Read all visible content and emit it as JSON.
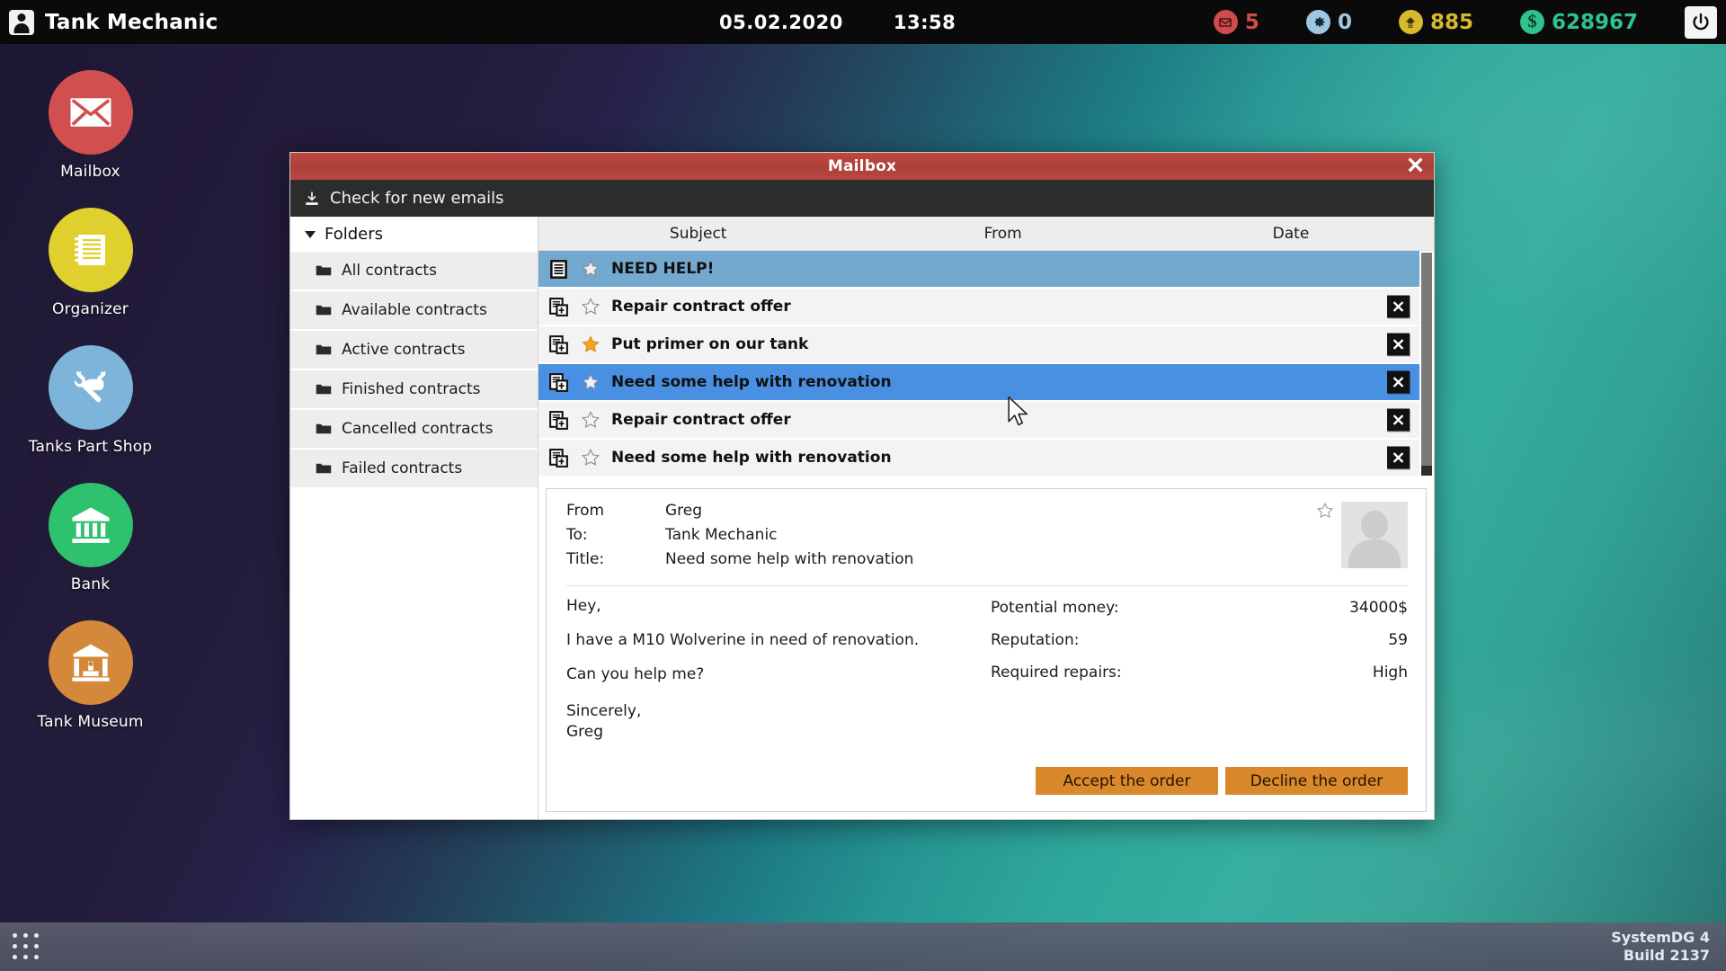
{
  "topbar": {
    "avatar_icon": "user-avatar-icon",
    "player_name": "Tank Mechanic",
    "date": "05.02.2020",
    "time": "13:58",
    "stats": [
      {
        "id": "mail",
        "icon": "mail-icon",
        "value": "5",
        "color": "#d14b4b"
      },
      {
        "id": "repairs",
        "icon": "gear-icon",
        "value": "0",
        "color": "#9fc6e3"
      },
      {
        "id": "reputation",
        "icon": "reputation-icon",
        "value": "885",
        "color": "#d8b92e"
      },
      {
        "id": "money",
        "icon": "dollar-icon",
        "value": "628967",
        "color": "#2ec28d"
      }
    ],
    "power_icon": "power-icon"
  },
  "desktop_icons": [
    {
      "label": "Mailbox",
      "icon": "envelope-icon",
      "color": "#d14f4f"
    },
    {
      "label": "Organizer",
      "icon": "notepad-icon",
      "color": "#e0d02e"
    },
    {
      "label": "Tanks Part Shop",
      "icon": "tank-wrench-icon",
      "color": "#7db4da"
    },
    {
      "label": "Bank",
      "icon": "bank-icon",
      "color": "#2ec26e"
    },
    {
      "label": "Tank Museum",
      "icon": "museum-icon",
      "color": "#d4883a"
    }
  ],
  "mailbox": {
    "title": "Mailbox",
    "close_label": "✕",
    "toolbar": {
      "icon": "download-icon",
      "check_label": "Check for new emails"
    },
    "folders": {
      "header": "Folders",
      "items": [
        {
          "label": "All contracts"
        },
        {
          "label": "Available contracts"
        },
        {
          "label": "Active contracts"
        },
        {
          "label": "Finished contracts"
        },
        {
          "label": "Cancelled contracts"
        },
        {
          "label": "Failed contracts"
        }
      ]
    },
    "list": {
      "columns": {
        "subject": "Subject",
        "from": "From",
        "date": "Date"
      },
      "rows": [
        {
          "subject": "NEED HELP!",
          "from": "",
          "date": "",
          "icon": "document-list-icon",
          "starred": false,
          "state": "selected-light",
          "deletable": false
        },
        {
          "subject": "Repair contract offer",
          "from": "",
          "date": "",
          "icon": "document-add-icon",
          "starred": false,
          "state": "normal",
          "deletable": true
        },
        {
          "subject": "Put primer on our tank",
          "from": "",
          "date": "",
          "icon": "document-add-icon",
          "starred": true,
          "state": "normal",
          "deletable": true
        },
        {
          "subject": "Need some help with renovation",
          "from": "",
          "date": "",
          "icon": "document-add-icon",
          "starred": false,
          "state": "selected-blue",
          "deletable": true
        },
        {
          "subject": "Repair contract offer",
          "from": "",
          "date": "",
          "icon": "document-add-icon",
          "starred": false,
          "state": "normal",
          "deletable": true
        },
        {
          "subject": "Need some help with renovation",
          "from": "",
          "date": "",
          "icon": "document-add-icon",
          "starred": false,
          "state": "normal",
          "deletable": true
        }
      ],
      "delete_icon": "close-x-icon"
    },
    "detail": {
      "from_label": "From",
      "from_value": "Greg",
      "to_label": "To:",
      "to_value": "Tank Mechanic",
      "title_label": "Title:",
      "title_value": "Need some help with renovation",
      "star_icon": "star-outline-icon",
      "avatar_icon": "contact-avatar-icon",
      "body_lines": {
        "greeting": "Hey,",
        "line1": "I have a M10 Wolverine in need of renovation.",
        "line2": "Can you help me?",
        "signoff": "Sincerely,",
        "signature": "Greg"
      },
      "stats": [
        {
          "label": "Potential money:",
          "value": "34000$"
        },
        {
          "label": "Reputation:",
          "value": "59"
        },
        {
          "label": "Required repairs:",
          "value": "High"
        }
      ],
      "accept_label": "Accept the order",
      "decline_label": "Decline the order"
    }
  },
  "taskbar": {
    "apps_icon": "apps-grid-icon",
    "system_name": "SystemDG 4",
    "build": "Build 2137"
  },
  "cursor": {
    "icon": "mouse-pointer-icon"
  }
}
